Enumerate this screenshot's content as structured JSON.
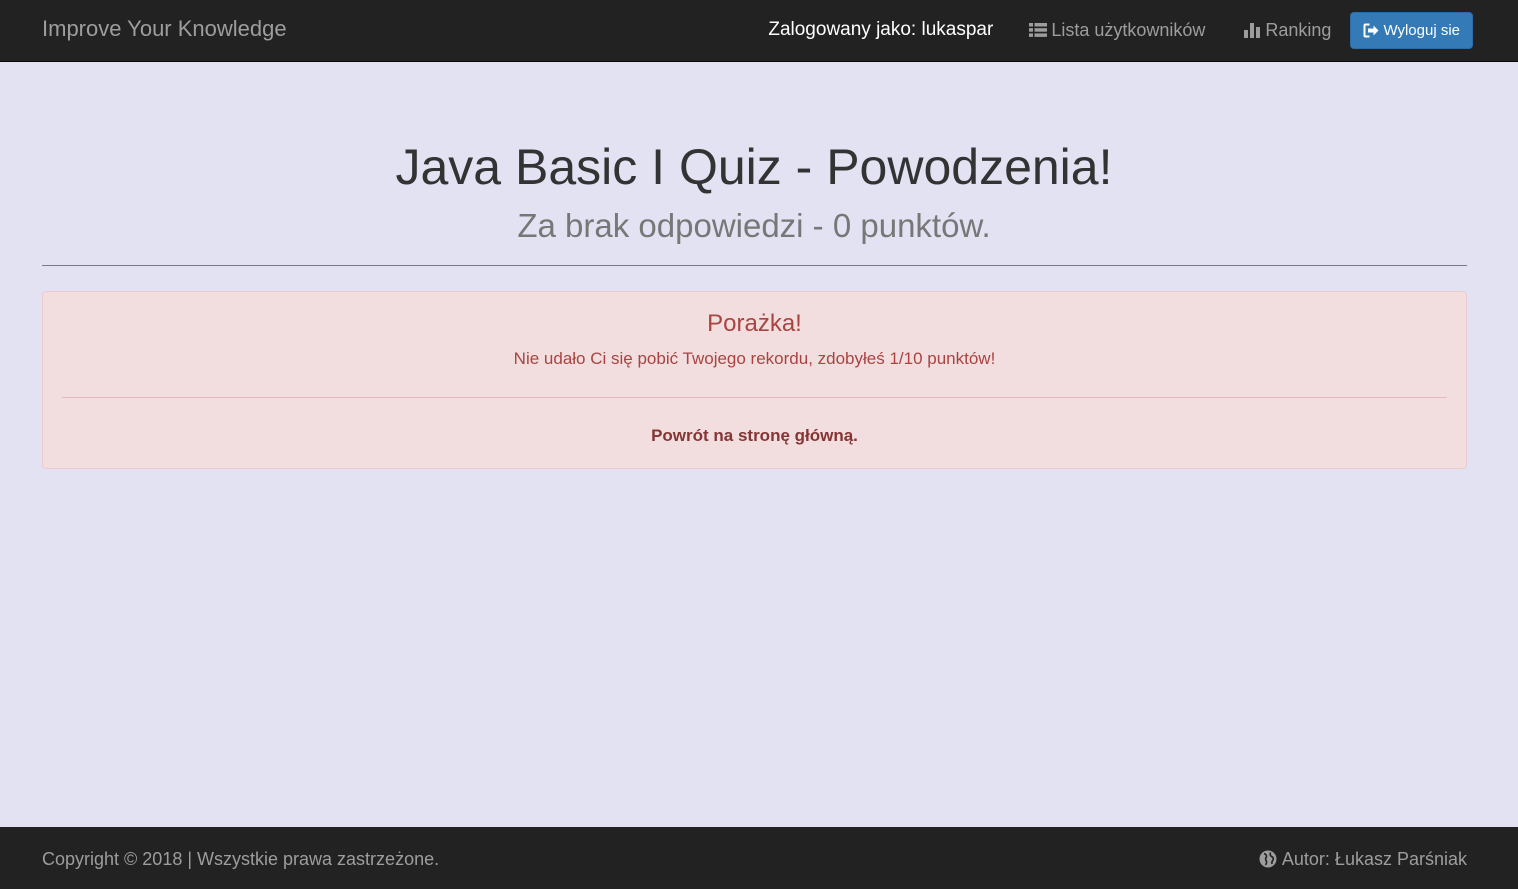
{
  "navbar": {
    "brand": "Improve Your Knowledge",
    "logged_in_as": "Zalogowany jako: lukaspar",
    "users_list_label": "Lista użytkowników",
    "ranking_label": "Ranking",
    "logout_label": "Wyloguj sie",
    "icons": {
      "users_list": "list-icon",
      "ranking": "bar-chart-icon",
      "logout": "sign-out-icon"
    }
  },
  "header": {
    "title": "Java Basic I Quiz - Powodzenia!",
    "subtitle": "Za brak odpowiedzi - 0 punktów."
  },
  "result_alert": {
    "title": "Porażka!",
    "message": "Nie udało Ci się pobić Twojego rekordu, zdobyłeś 1/10 punktów!",
    "back_link": "Powrót na stronę główną."
  },
  "footer": {
    "copyright": "Copyright © 2018 | Wszystkie prawa zastrzeżone.",
    "author": "Autor: Łukasz Parśniak",
    "author_icon": "globe-icon"
  },
  "colors": {
    "navbar_bg": "#222222",
    "page_bg": "#e2e2f3",
    "alert_bg": "#f2dede",
    "alert_text": "#a94442",
    "button_primary": "#337ab7"
  }
}
